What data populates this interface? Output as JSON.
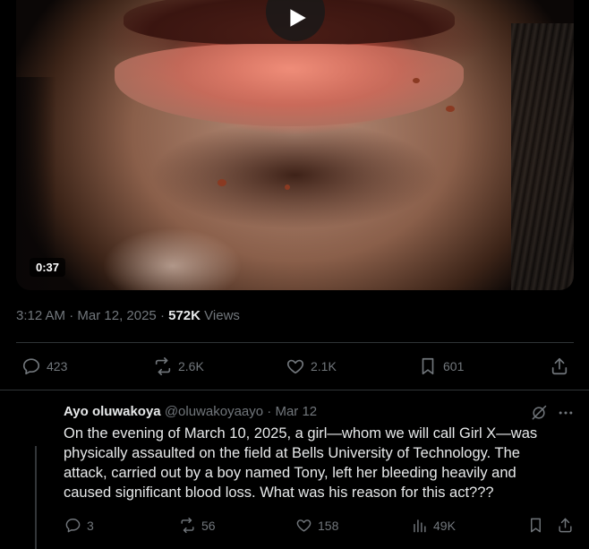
{
  "video": {
    "duration": "0:37"
  },
  "post": {
    "time": "3:12 AM",
    "date": "Mar 12, 2025",
    "separator": "·",
    "views_count": "572K",
    "views_label": "Views",
    "actions": {
      "replies": "423",
      "reposts": "2.6K",
      "likes": "2.1K",
      "bookmarks": "601"
    }
  },
  "reply": {
    "name": "Ayo oluwakoya",
    "handle": "@oluwakoyaayo",
    "separator": "·",
    "date": "Mar 12",
    "text": "On the evening of March 10, 2025, a girl—whom we will call Girl X—was physically assaulted on the field at Bells University of Technology. The attack, carried out by a boy named Tony, left her bleeding heavily and caused significant blood loss. What was his reason for this act???",
    "actions": {
      "replies": "3",
      "reposts": "56",
      "likes": "158",
      "views": "49K"
    }
  },
  "colors": {
    "background": "#000000",
    "text_primary": "#e7e9ea",
    "text_secondary": "#71767b",
    "divider": "#2f3336"
  }
}
